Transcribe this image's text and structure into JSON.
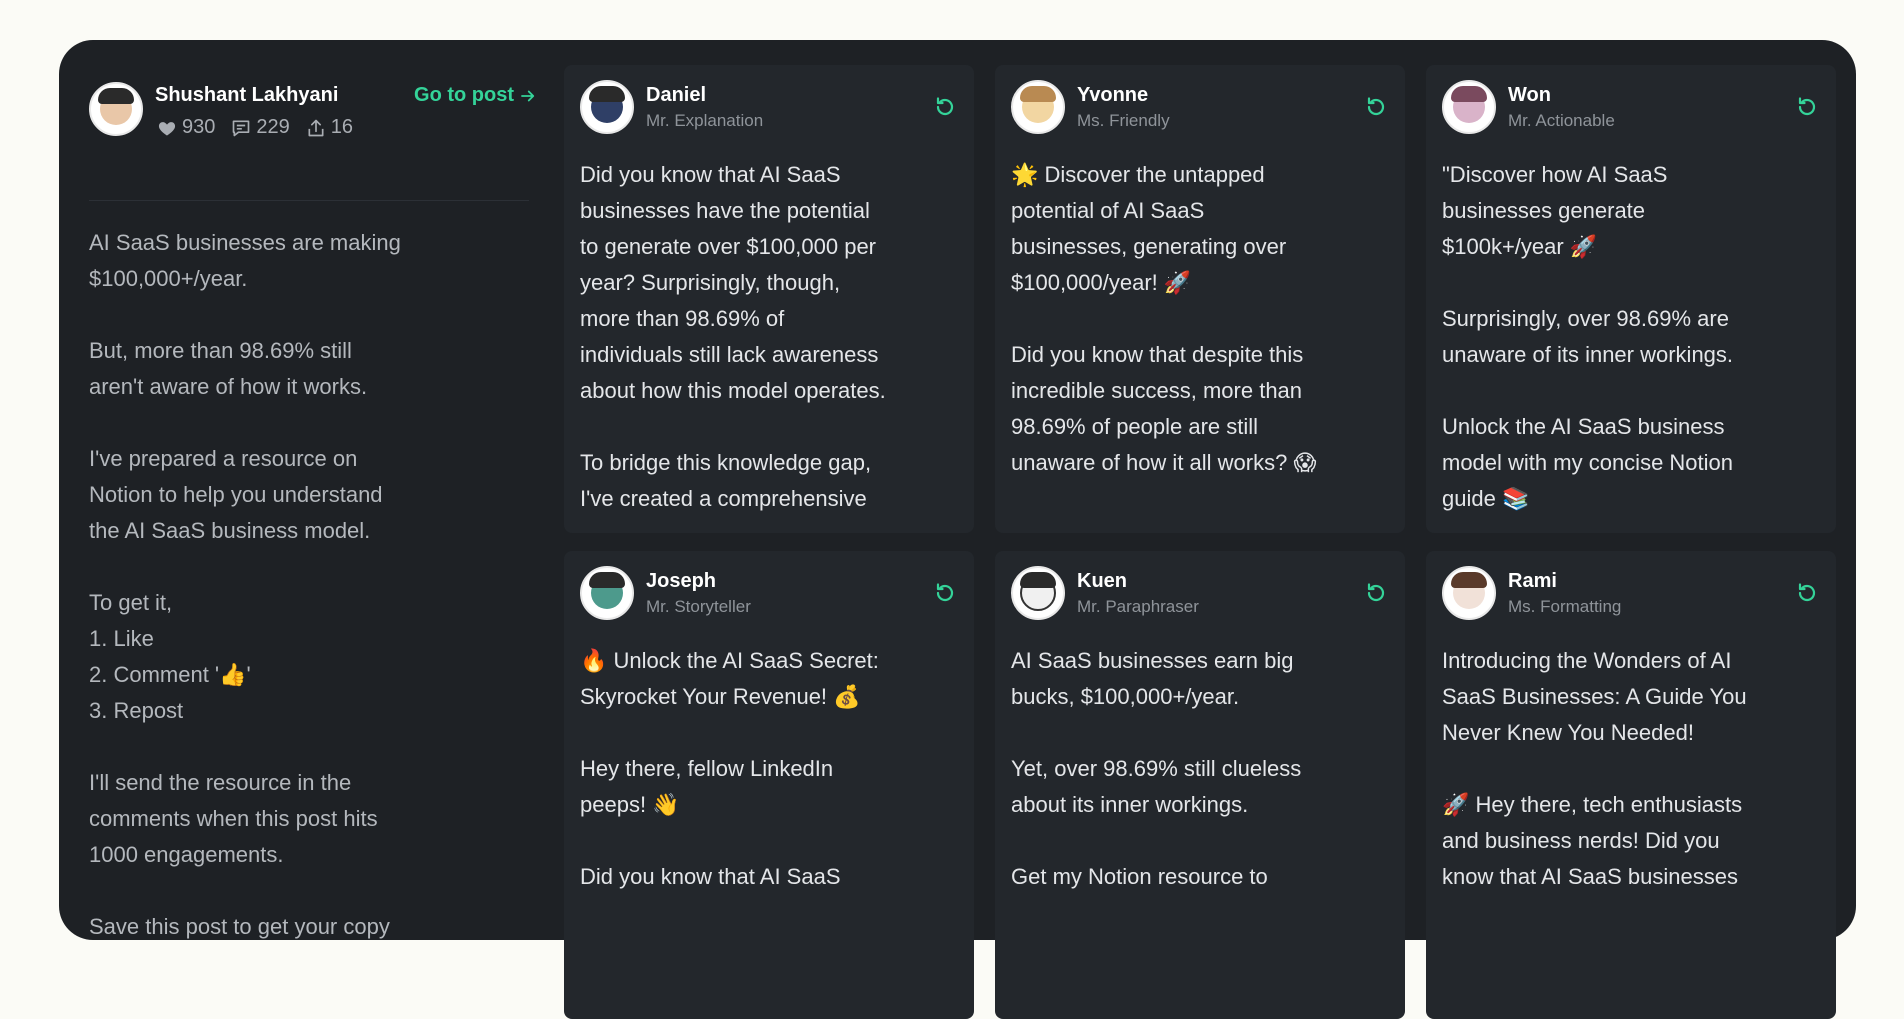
{
  "original_post": {
    "author": "Shushant Lakhyani",
    "likes": "930",
    "comments": "229",
    "reposts": "16",
    "go_to_post": "Go to post",
    "text": "AI SaaS businesses are making\n$100,000+/year.\n\nBut, more than 98.69% still\naren't aware of how it works.\n\nI've prepared a resource on\nNotion to help you understand\nthe AI SaaS business model.\n\nTo get it,\n1. Like\n2. Comment '👍'\n3. Repost\n\nI'll send the resource in the\ncomments when this post hits\n1000 engagements.\n\nSave this post to get your copy"
  },
  "variations": [
    {
      "name": "Daniel",
      "role": "Mr. Explanation",
      "avatar_color": "#2f3f66",
      "text": "Did you know that AI SaaS\nbusinesses have the potential\nto generate over $100,000 per\nyear? Surprisingly, though,\nmore than 98.69% of\nindividuals still lack awareness\nabout how this model operates.\n\nTo bridge this knowledge gap,\nI've created a comprehensive"
    },
    {
      "name": "Yvonne",
      "role": "Ms. Friendly",
      "avatar_color": "#f2d6a2",
      "text": "🌟 Discover the untapped\npotential of AI SaaS\nbusinesses, generating over\n$100,000/year! 🚀\n\nDid you know that despite this\nincredible success, more than\n98.69% of people are still\nunaware of how it all works? 😱"
    },
    {
      "name": "Won",
      "role": "Mr. Actionable",
      "avatar_color": "#d9b3c9",
      "text": "\"Discover how AI SaaS\nbusinesses generate\n$100k+/year 🚀\n\nSurprisingly, over 98.69% are\nunaware of its inner workings.\n\nUnlock the AI SaaS business\nmodel with my concise Notion\nguide 📚"
    },
    {
      "name": "Joseph",
      "role": "Mr. Storyteller",
      "avatar_color": "#4d9a8c",
      "text": "🔥 Unlock the AI SaaS Secret:\nSkyrocket Your Revenue! 💰\n\nHey there, fellow LinkedIn\npeeps! 👋\n\nDid you know that AI SaaS"
    },
    {
      "name": "Kuen",
      "role": "Mr. Paraphraser",
      "avatar_color": "#f0f0f0",
      "text": "AI SaaS businesses earn big\nbucks, $100,000+/year.\n\nYet, over 98.69% still clueless\nabout its inner workings.\n\nGet my Notion resource to"
    },
    {
      "name": "Rami",
      "role": "Ms. Formatting",
      "avatar_color": "#f1e1d8",
      "text": "Introducing the Wonders of AI\nSaaS Businesses: A Guide You\nNever Knew You Needed!\n\n🚀 Hey there, tech enthusiasts\nand business nerds! Did you\nknow that AI SaaS businesses"
    }
  ],
  "colors": {
    "accent": "#34d399",
    "panel": "#1e2125",
    "card": "#23272c",
    "page": "#fbfbf6"
  },
  "icons": {
    "like": "heart-icon",
    "comment": "comment-icon",
    "repost": "share-icon",
    "regenerate": "refresh-icon",
    "go_to_post": "arrow-right-icon"
  }
}
